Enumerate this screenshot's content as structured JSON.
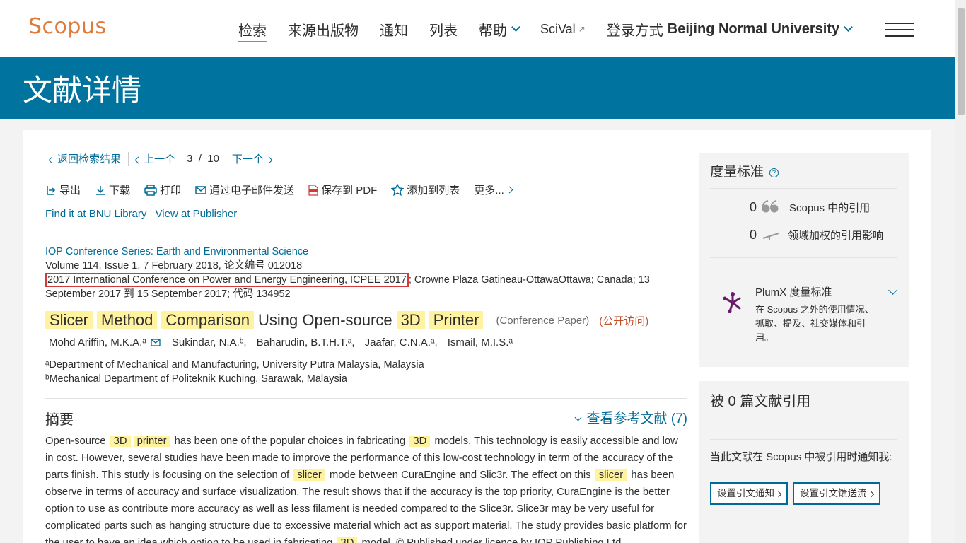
{
  "header": {
    "logo": "Scopus",
    "nav": {
      "search": "检索",
      "sources": "来源出版物",
      "alerts": "通知",
      "lists": "列表",
      "help": "帮助",
      "scival": "SciVal",
      "login_prefix": "登录方式",
      "institution": "Beijing Normal University"
    }
  },
  "banner": {
    "title": "文献详情"
  },
  "pager": {
    "back": "返回检索结果",
    "prev": "上一个",
    "current": "3",
    "slash": "/",
    "total": "10",
    "next": "下一个"
  },
  "actions": {
    "export": "导出",
    "download": "下载",
    "print": "打印",
    "email": "通过电子邮件发送",
    "save_pdf": "保存到 PDF",
    "add_list": "添加到列表",
    "more": "更多..."
  },
  "links": {
    "library": "Find it at BNU Library",
    "publisher": "View at Publisher"
  },
  "source": {
    "journal": "IOP Conference Series: Earth and Environmental Science",
    "volume_line": "Volume 114, Issue 1, 7 February 2018, 论文编号 012018",
    "conference": "2017 International Conference on Power and Energy Engineering, ICPEE 2017",
    "venue_rest": "; Crowne Plaza Gatineau-OttawaOttawa; Canada; 13",
    "dates_line": "September 2017 到 15 September 2017; 代码 134952"
  },
  "title": {
    "w1": "Slicer",
    "w2": "Method",
    "w3": "Comparison",
    "plain": "Using Open-source",
    "w4": "3D",
    "w5": "Printer",
    "type": "(Conference Paper)",
    "open_access": "(公开访问)"
  },
  "authors": [
    "Mohd Ariffin, M.K.A.ᵃ",
    "Sukindar, N.A.ᵇ,",
    "Baharudin, B.T.H.T.ᵃ,",
    "Jaafar, C.N.A.ᵃ,",
    "Ismail, M.I.S.ᵃ"
  ],
  "affiliations": {
    "a": "ᵃDepartment of Mechanical and Manufacturing, University Putra Malaysia, Malaysia",
    "b": "ᵇMechanical Department of Politeknik Kuching, Sarawak, Malaysia"
  },
  "abstract": {
    "heading": "摘要",
    "refs_link": "查看参考文献 (7)",
    "t1": "Open-source",
    "h1": "3D",
    "h2": "printer",
    "t2": "has been one of the popular choices in fabricating",
    "h3": "3D",
    "t3": "models. This technology is easily accessible and low in cost. However, several studies have been made to improve the performance of this low-cost technology in term of the accuracy of the parts finish. This study is focusing on the selection of",
    "h4": "slicer",
    "t4": "mode between CuraEngine and Slic3r. The effect on this",
    "h5": "slicer",
    "t5": "has been observe in terms of accuracy and surface visualization. The result shows that if the accuracy is the top priority, CuraEngine is the better option to use as contribute more accuracy as well as less filament is needed compared to the Slice3r. Slice3r may be very useful for complicated parts such as hanging structure due to excessive material which act as support material. The study provides basic platform for the user to have an idea which option to be used in fabricating",
    "h6": "3D",
    "t6": "model. © Published under licence by IOP Publishing Ltd."
  },
  "metrics": {
    "heading": "度量标准",
    "citations_count": "0",
    "citations_label": "Scopus 中的引用",
    "fwci_count": "0",
    "fwci_label": "领域加权的引用影响",
    "plumx_title": "PlumX 度量标准",
    "plumx_desc": "在 Scopus 之外的使用情况、抓取、提及、社交媒体和引用。"
  },
  "cited": {
    "heading": "被 0 篇文献引用",
    "notify_text": "当此文献在 Scopus 中被引用时通知我:",
    "btn_alert": "设置引文通知",
    "btn_feed": "设置引文馈送流"
  },
  "colors": {
    "brand_orange": "#e07a3a",
    "banner_blue": "#00739e",
    "link_blue": "#006b96",
    "highlight": "#fff3a0",
    "conference_box": "#d13a3a"
  }
}
